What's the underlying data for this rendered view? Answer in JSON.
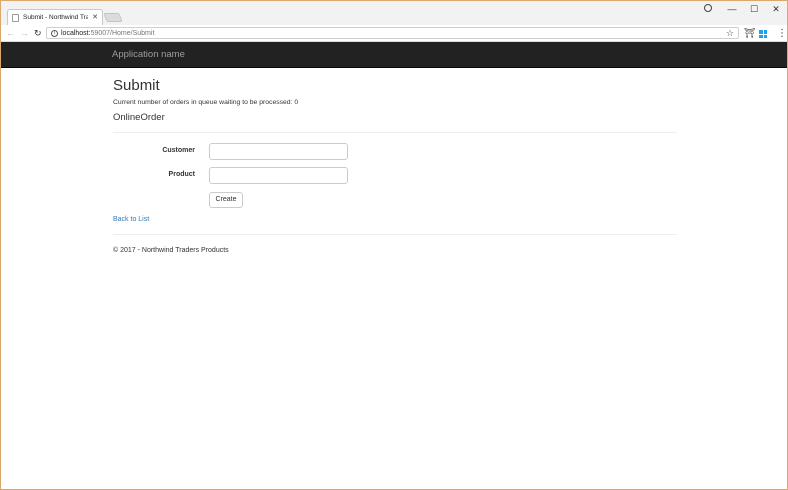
{
  "browser": {
    "tab_title": "Submit - Northwind Tra",
    "tab_close": "✕",
    "url_host": "localhost:",
    "url_rest": "59007/Home/Submit",
    "window_controls": {
      "minimize": "—",
      "maximize": "☐",
      "close": "✕"
    },
    "nav": {
      "back": "←",
      "forward": "→",
      "reload": "↻"
    },
    "icons": {
      "info": "i",
      "star": "☆",
      "extension": "⛩",
      "menu": "⋮"
    }
  },
  "navbar": {
    "brand": "Application name"
  },
  "page": {
    "title": "Submit",
    "queue_text": "Current number of orders in queue waiting to be processed: 0",
    "section_title": "OnlineOrder"
  },
  "form": {
    "customer_label": "Customer",
    "customer_value": "",
    "product_label": "Product",
    "product_value": "",
    "create_label": "Create"
  },
  "links": {
    "back_to_list": "Back to List"
  },
  "footer": {
    "text": "© 2017 - Northwind Traders Products"
  },
  "colors": {
    "navbar_bg": "#222222",
    "brand_text": "#9d9d9d",
    "link": "#337ab7",
    "window_border": "#d9a86a",
    "windows_logo": "#1fa1e8"
  }
}
